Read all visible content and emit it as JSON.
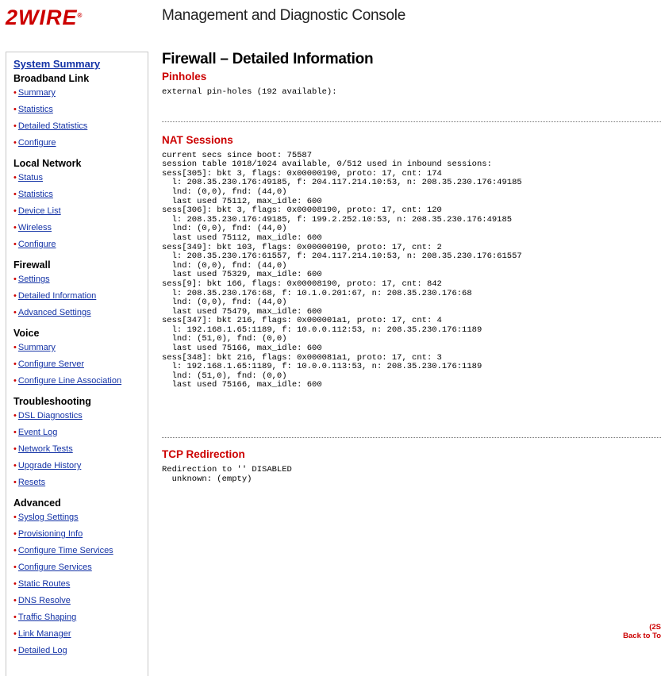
{
  "header": {
    "logo_text": "2WIRE",
    "logo_mark": "®",
    "console_title": "Management and Diagnostic Console"
  },
  "sidebar": {
    "system_summary": "System Summary",
    "sections": [
      {
        "title": "Broadband Link",
        "items": [
          "Summary",
          "Statistics",
          "Detailed Statistics",
          "Configure"
        ]
      },
      {
        "title": "Local Network",
        "items": [
          "Status",
          "Statistics",
          "Device List",
          "Wireless",
          "Configure"
        ]
      },
      {
        "title": "Firewall",
        "items": [
          "Settings",
          "Detailed Information",
          "Advanced Settings"
        ]
      },
      {
        "title": "Voice",
        "items": [
          "Summary",
          "Configure Server",
          "Configure Line Association"
        ]
      },
      {
        "title": "Troubleshooting",
        "items": [
          "DSL Diagnostics",
          "Event Log",
          "Network Tests",
          "Upgrade History",
          "Resets"
        ]
      },
      {
        "title": "Advanced",
        "items": [
          "Syslog Settings",
          "Provisioning Info",
          "Configure Time Services",
          "Configure Services",
          "Static Routes",
          "DNS Resolve",
          "Traffic Shaping",
          "Link Manager",
          "Detailed Log"
        ]
      }
    ]
  },
  "main": {
    "page_title": "Firewall – Detailed Information",
    "pinholes": {
      "title": "Pinholes",
      "text": "external pin-holes (192 available):"
    },
    "nat": {
      "title": "NAT Sessions",
      "text": "current secs since boot: 75587\nsession table 1018/1024 available, 0/512 used in inbound sessions:\nsess[305]: bkt 3, flags: 0x00000190, proto: 17, cnt: 174\n  l: 208.35.230.176:49185, f: 204.117.214.10:53, n: 208.35.230.176:49185\n  lnd: (0,0), fnd: (44,0)\n  last used 75112, max_idle: 600\nsess[306]: bkt 3, flags: 0x00008190, proto: 17, cnt: 120\n  l: 208.35.230.176:49185, f: 199.2.252.10:53, n: 208.35.230.176:49185\n  lnd: (0,0), fnd: (44,0)\n  last used 75112, max_idle: 600\nsess[349]: bkt 103, flags: 0x00000190, proto: 17, cnt: 2\n  l: 208.35.230.176:61557, f: 204.117.214.10:53, n: 208.35.230.176:61557\n  lnd: (0,0), fnd: (44,0)\n  last used 75329, max_idle: 600\nsess[9]: bkt 166, flags: 0x00008190, proto: 17, cnt: 842\n  l: 208.35.230.176:68, f: 10.1.0.201:67, n: 208.35.230.176:68\n  lnd: (0,0), fnd: (44,0)\n  last used 75479, max_idle: 600\nsess[347]: bkt 216, flags: 0x000001a1, proto: 17, cnt: 4\n  l: 192.168.1.65:1189, f: 10.0.0.112:53, n: 208.35.230.176:1189\n  lnd: (51,0), fnd: (0,0)\n  last used 75166, max_idle: 600\nsess[348]: bkt 216, flags: 0x000081a1, proto: 17, cnt: 3\n  l: 192.168.1.65:1189, f: 10.0.0.113:53, n: 208.35.230.176:1189\n  lnd: (51,0), fnd: (0,0)\n  last used 75166, max_idle: 600"
    },
    "tcp": {
      "title": "TCP Redirection",
      "text": "Redirection to '' DISABLED\n  unknown: (empty)"
    }
  },
  "footer": {
    "copyright_fragment": "(2S",
    "back_to_top": "Back to To"
  },
  "colors": {
    "brand_red": "#cc0000",
    "link_blue": "#1433a6"
  }
}
